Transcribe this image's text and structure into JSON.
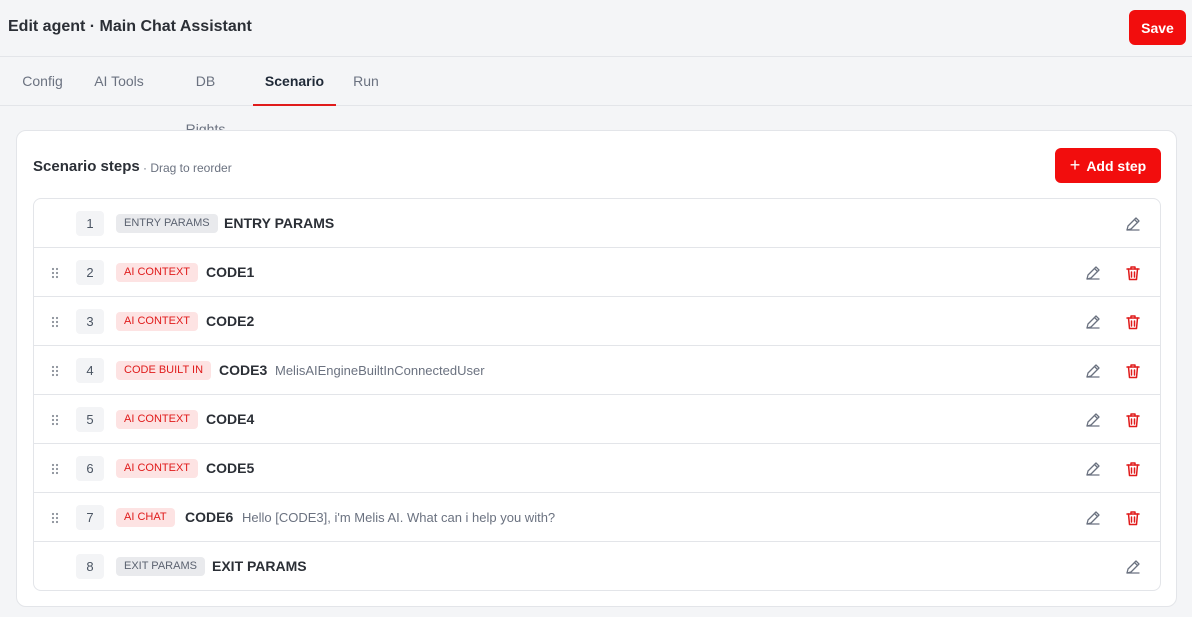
{
  "header": {
    "title": "Edit agent · Main Chat Assistant",
    "save_label": "Save"
  },
  "tabs": [
    {
      "label": "Config",
      "active": false
    },
    {
      "label": "AI Tools",
      "active": false
    },
    {
      "label": "DB Rights",
      "active": false
    },
    {
      "label": "Scenario",
      "active": true
    },
    {
      "label": "Run",
      "active": false
    }
  ],
  "scenario": {
    "title": "Scenario steps",
    "subtitle": "· Drag to reorder",
    "add_label": "Add step",
    "steps": [
      {
        "number": "1",
        "type": "ENTRY PARAMS",
        "name": "ENTRY PARAMS",
        "description": ""
      },
      {
        "number": "2",
        "type": "AI CONTEXT",
        "name": "CODE1",
        "description": ""
      },
      {
        "number": "3",
        "type": "AI CONTEXT",
        "name": "CODE2",
        "description": ""
      },
      {
        "number": "4",
        "type": "CODE BUILT IN",
        "name": "CODE3",
        "description": "MelisAIEngineBuiltInConnectedUser"
      },
      {
        "number": "5",
        "type": "AI CONTEXT",
        "name": "CODE4",
        "description": ""
      },
      {
        "number": "6",
        "type": "AI CONTEXT",
        "name": "CODE5",
        "description": ""
      },
      {
        "number": "7",
        "type": "AI CHAT",
        "name": "CODE6",
        "description": "Hello [CODE3], i'm Melis AI. What can i help you with?"
      },
      {
        "number": "8",
        "type": "EXIT PARAMS",
        "name": "EXIT PARAMS",
        "description": ""
      }
    ]
  },
  "colors": {
    "accent": "#f20d0d",
    "badge_red_bg": "#fde3e3",
    "badge_gray_bg": "#e9eaed"
  },
  "icons": {
    "drag": "drag-handle-icon",
    "edit": "pencil-icon",
    "delete": "trash-icon",
    "add": "plus-icon"
  }
}
